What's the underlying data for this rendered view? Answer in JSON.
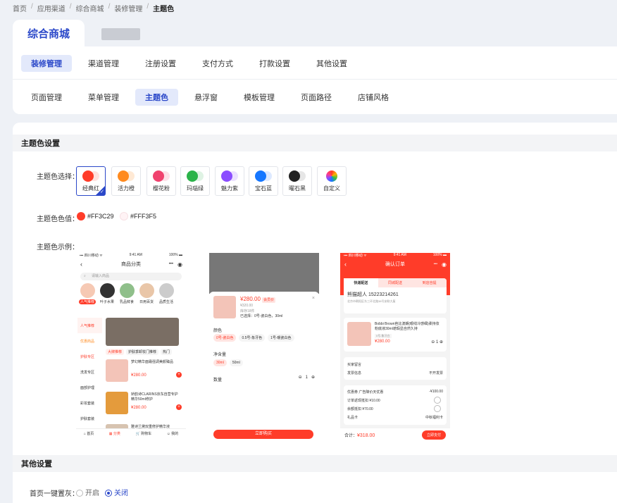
{
  "breadcrumb": [
    "首页",
    "应用渠道",
    "综合商城",
    "装修管理",
    "主题色"
  ],
  "top_tab": "综合商城",
  "nav_row1": [
    "装修管理",
    "渠道管理",
    "注册设置",
    "支付方式",
    "打款设置",
    "其他设置"
  ],
  "nav_row2": [
    "页面管理",
    "菜单管理",
    "主题色",
    "悬浮窗",
    "模板管理",
    "页面路径",
    "店铺风格"
  ],
  "theme": {
    "section_title": "主题色设置",
    "select_label": "主题色选择：",
    "value_label": "主题色色值：",
    "example_label": "主题色示例：",
    "swatches": [
      {
        "name": "经典红",
        "c1": "#ff3c29",
        "c2": "#ffe2df"
      },
      {
        "name": "活力橙",
        "c1": "#ff8a1e",
        "c2": "#ffe9d4"
      },
      {
        "name": "樱花粉",
        "c1": "#f0426e",
        "c2": "#fde1e8"
      },
      {
        "name": "玛瑙绿",
        "c1": "#2bb34a",
        "c2": "#dff3e4"
      },
      {
        "name": "魅力紫",
        "c1": "#8b4dff",
        "c2": "#ebe1ff"
      },
      {
        "name": "宝石蓝",
        "c1": "#1677ff",
        "c2": "#dde9ff"
      },
      {
        "name": "曜石黑",
        "c1": "#222222",
        "c2": "#e6e6e6"
      },
      {
        "name": "自定义",
        "c1": "",
        "c2": ""
      }
    ],
    "selected": "经典红",
    "primary_value": "#FF3C29",
    "secondary_value": "#FFF3F5"
  },
  "preview1": {
    "status_left": "▪▪▪ 四川移动 ᯤ",
    "status_time": "9:41 AM",
    "status_right": "100% ▬",
    "title": "商品分类",
    "search_placeholder": "请输入商品",
    "cat_labels": [
      "人气推荐",
      "叶子水果",
      "乳品鲜食",
      "日用百货",
      "品质生活"
    ],
    "side_items": [
      "人气推荐",
      "优惠商品",
      "护肤专区",
      "洗发专区",
      "面部护理",
      "彩妆套装",
      "护肤套装"
    ],
    "filter_tabs": [
      "大牌推荐",
      "护肤季卸妆门推荐",
      "热门"
    ],
    "products": [
      {
        "title": "梦幻精华面霜强调美颜臻品",
        "price": "¥280.00",
        "orig": "¥320.00"
      },
      {
        "title": "娇韵诗CLARINS京东自营专护精华50ml修护",
        "price": "¥280.00",
        "orig": "¥320.00"
      },
      {
        "title": "雅诗兰黛双重修护精华液",
        "price": "",
        "orig": ""
      }
    ],
    "tabbar": [
      "首页",
      "分类",
      "购物车",
      "我的"
    ]
  },
  "preview2": {
    "price": "¥280.00",
    "tag": "会员价",
    "orig": "¥320.00",
    "stock": "库存18件",
    "selected": "已选择：0号-瓷白色，30ml",
    "color_label": "颜色",
    "colors": [
      "0号-瓷白色",
      "0.5号-象牙色",
      "1号-暖瓷白色"
    ],
    "volume_label": "净含量",
    "volumes": [
      "30ml",
      "50ml"
    ],
    "qty_label": "数量",
    "qty": "1",
    "buy_button": "立即购买"
  },
  "preview3": {
    "status_left": "▪▪▪ 四川移动 ᯤ",
    "status_time": "9:41 AM",
    "status_right": "100% ▬",
    "title": "确认订单",
    "delivery_tabs": [
      "快递配送",
      "同城配送",
      "到店自提"
    ],
    "receiver": "熊猫超人  15223214261",
    "address": "北京市朝阳区东三环北路38号安联大厦",
    "product_title": "Bobbi Brown芭比波朗(眼线冷感细)柔持妆粉底液30ml遮瑕显自然久持",
    "product_spec": "0号-象牙白",
    "product_price": "¥280.00",
    "qty": "1",
    "rows1": [
      {
        "k": "买家留言",
        "v": ""
      },
      {
        "k": "发票信息",
        "v": "不开发票"
      }
    ],
    "rows2": [
      {
        "k": "优惠券  广告降价天优惠",
        "v": "-¥100.00"
      },
      {
        "k": "订单返现抵扣 ¥10.00",
        "v": ""
      },
      {
        "k": "余额抵扣 ¥70.00",
        "v": ""
      },
      {
        "k": "礼品卡",
        "v": "中秋福利卡"
      }
    ],
    "total_label": "合计：",
    "total": "¥318.00",
    "submit": "立即支付"
  },
  "other": {
    "section_title": "其他设置",
    "gray_label": "首页一键置灰：",
    "opt_on": "开启",
    "opt_off": "关闭",
    "selected": "关闭"
  }
}
